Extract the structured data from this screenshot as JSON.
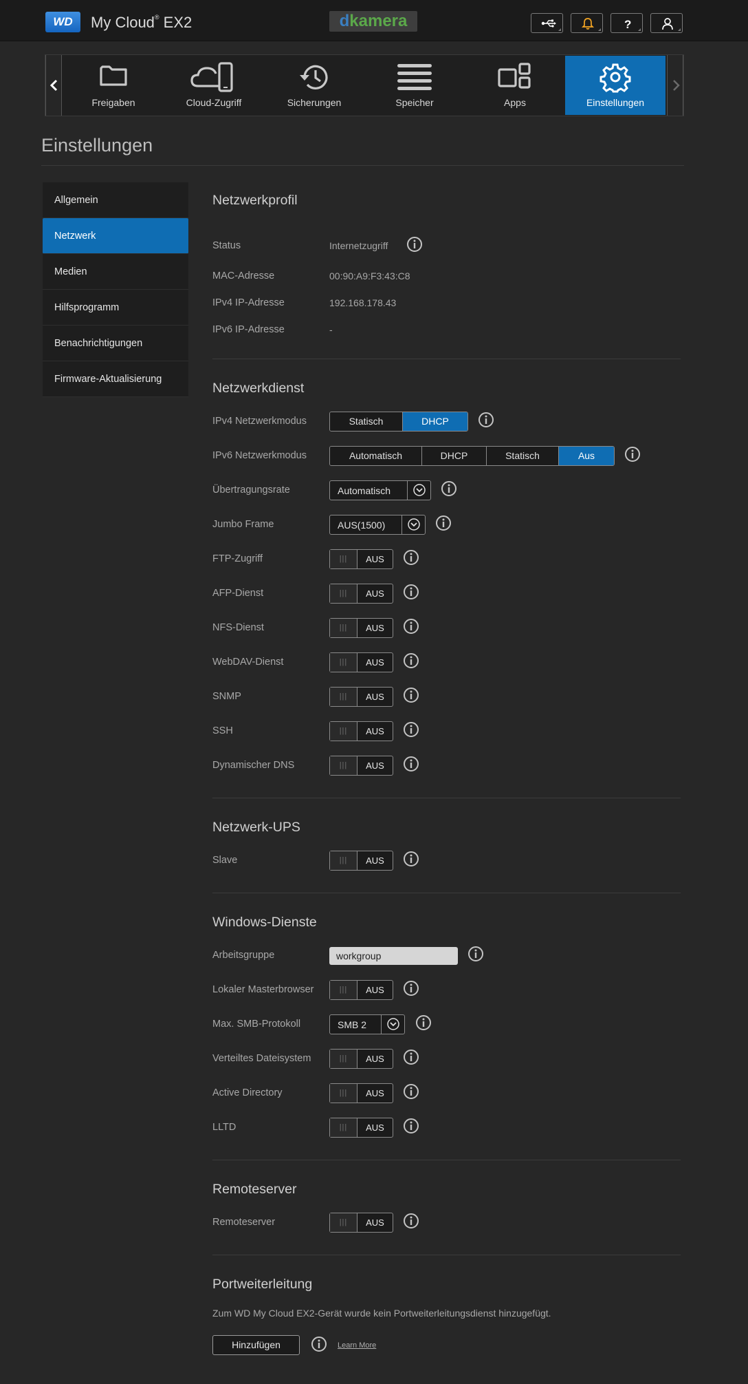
{
  "header": {
    "logo_text": "WD",
    "product_name": "My Cloud",
    "product_reg": "®",
    "product_model": " EX2",
    "camera_logo_d": "d",
    "camera_logo_rest": "kamera",
    "icons": [
      "usb-icon",
      "bell-icon",
      "help-icon",
      "user-icon"
    ]
  },
  "nav": {
    "items": [
      {
        "label": "Freigaben",
        "icon": "folder-icon"
      },
      {
        "label": "Cloud-Zugriff",
        "icon": "cloud-device-icon"
      },
      {
        "label": "Sicherungen",
        "icon": "history-icon"
      },
      {
        "label": "Speicher",
        "icon": "storage-icon"
      },
      {
        "label": "Apps",
        "icon": "apps-icon"
      },
      {
        "label": "Einstellungen",
        "icon": "gear-icon"
      }
    ],
    "active": "Einstellungen"
  },
  "page_title": "Einstellungen",
  "sidebar": {
    "items": [
      "Allgemein",
      "Netzwerk",
      "Medien",
      "Hilfsprogramm",
      "Benachrichtigungen",
      "Firmware-Aktualisierung"
    ],
    "active": "Netzwerk"
  },
  "profile": {
    "title": "Netzwerkprofil",
    "rows": [
      {
        "label": "Status",
        "value": "Internetzugriff"
      },
      {
        "label": "MAC-Adresse",
        "value": "00:90:A9:F3:43:C8"
      },
      {
        "label": "IPv4 IP-Adresse",
        "value": "192.168.178.43"
      },
      {
        "label": "IPv6 IP-Adresse",
        "value": "-"
      }
    ]
  },
  "service": {
    "title": "Netzwerkdienst",
    "ipv4": {
      "label": "IPv4 Netzwerkmodus",
      "options": [
        "Statisch",
        "DHCP"
      ],
      "selected": "DHCP"
    },
    "ipv6": {
      "label": "IPv6 Netzwerkmodus",
      "options": [
        "Automatisch",
        "DHCP",
        "Statisch",
        "Aus"
      ],
      "selected": "Aus"
    },
    "rate": {
      "label": "Übertragungsrate",
      "value": "Automatisch"
    },
    "jumbo": {
      "label": "Jumbo Frame",
      "value": "AUS(1500)"
    },
    "toggles": [
      {
        "label": "FTP-Zugriff",
        "state": "AUS"
      },
      {
        "label": "AFP-Dienst",
        "state": "AUS"
      },
      {
        "label": "NFS-Dienst",
        "state": "AUS"
      },
      {
        "label": "WebDAV-Dienst",
        "state": "AUS"
      },
      {
        "label": "SNMP",
        "state": "AUS"
      },
      {
        "label": "SSH",
        "state": "AUS"
      },
      {
        "label": "Dynamischer DNS",
        "state": "AUS"
      }
    ]
  },
  "ups": {
    "title": "Netzwerk-UPS",
    "slave": {
      "label": "Slave",
      "state": "AUS"
    }
  },
  "windows": {
    "title": "Windows-Dienste",
    "workgroup": {
      "label": "Arbeitsgruppe",
      "value": "workgroup"
    },
    "master": {
      "label": "Lokaler Masterbrowser",
      "state": "AUS"
    },
    "smb": {
      "label": "Max. SMB-Protokoll",
      "value": "SMB 2"
    },
    "dfs": {
      "label": "Verteiltes Dateisystem",
      "state": "AUS"
    },
    "ad": {
      "label": "Active Directory",
      "state": "AUS"
    },
    "lltd": {
      "label": "LLTD",
      "state": "AUS"
    }
  },
  "remote": {
    "title": "Remoteserver",
    "row": {
      "label": "Remoteserver",
      "state": "AUS"
    }
  },
  "portfwd": {
    "title": "Portweiterleitung",
    "text": "Zum WD My Cloud EX2-Gerät wurde kein Portweiterleitungsdienst hinzugefügt.",
    "add_label": "Hinzufügen",
    "learn_more": "Learn More"
  },
  "toggle_grip": "|||",
  "colors": {
    "accent": "#0f6db3",
    "bell": "#f5a623",
    "background": "#272727"
  }
}
